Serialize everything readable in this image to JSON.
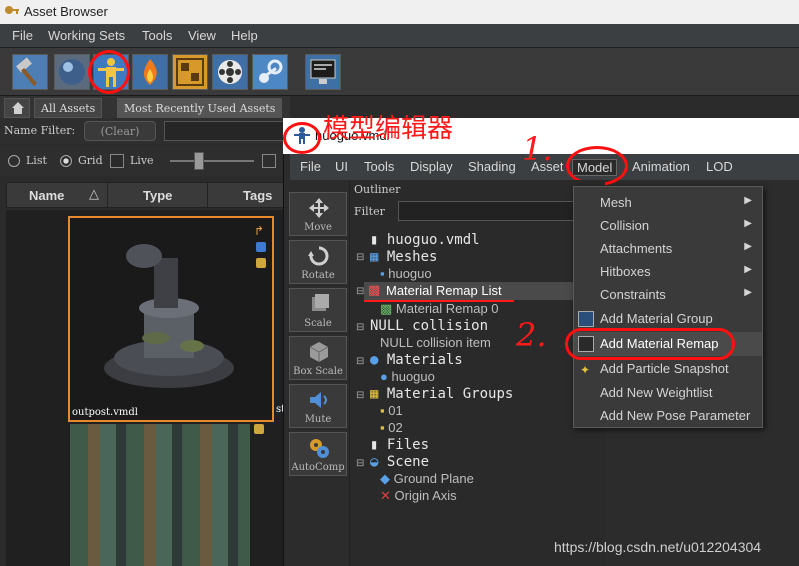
{
  "window": {
    "title": "Asset Browser"
  },
  "menubar": [
    "File",
    "Working Sets",
    "Tools",
    "View",
    "Help"
  ],
  "tabs": {
    "all": "All Assets",
    "recent": "Most Recently Used Assets"
  },
  "filter": {
    "label": "Name Filter:",
    "clear": "(Clear)"
  },
  "view": {
    "list": "List",
    "grid": "Grid",
    "live": "Live"
  },
  "columns": {
    "name": "Name",
    "type": "Type",
    "tags": "Tags"
  },
  "assets": [
    {
      "name": "outpost.vmdl"
    },
    {
      "name": "st"
    }
  ],
  "annotation": {
    "model_editor_cn": "模型编辑器",
    "step1": "1.",
    "step2": "2."
  },
  "model_editor": {
    "file": "huoguo.vmdl",
    "menus": [
      "File",
      "UI",
      "Tools",
      "Display",
      "Shading",
      "Asset",
      "Model",
      "Animation",
      "LOD"
    ],
    "tools": [
      "Move",
      "Rotate",
      "Scale",
      "Box Scale",
      "Mute",
      "AutoComp"
    ],
    "outliner": {
      "title": "Outliner",
      "filter_label": "Filter",
      "items": [
        {
          "label": "huoguo.vmdl",
          "kind": "head"
        },
        {
          "label": "Meshes",
          "kind": "head"
        },
        {
          "label": "huoguo",
          "kind": "leaf"
        },
        {
          "label": "Material Remap List",
          "kind": "leaf"
        },
        {
          "label": "Material Remap 0",
          "kind": "leaf"
        },
        {
          "label": "NULL collision",
          "kind": "head"
        },
        {
          "label": "NULL collision item",
          "kind": "leaf"
        },
        {
          "label": "Materials",
          "kind": "head"
        },
        {
          "label": "huoguo",
          "kind": "leaf"
        },
        {
          "label": "Material Groups",
          "kind": "head"
        },
        {
          "label": "01",
          "kind": "leaf"
        },
        {
          "label": "02",
          "kind": "leaf"
        },
        {
          "label": "Files",
          "kind": "head"
        },
        {
          "label": "Scene",
          "kind": "head"
        },
        {
          "label": "Ground Plane",
          "kind": "leaf"
        },
        {
          "label": "Origin Axis",
          "kind": "leaf"
        }
      ]
    },
    "model_menu": [
      {
        "label": "Mesh",
        "submenu": true
      },
      {
        "label": "Collision",
        "submenu": true
      },
      {
        "label": "Attachments",
        "submenu": true
      },
      {
        "label": "Hitboxes",
        "submenu": true
      },
      {
        "label": "Constraints",
        "submenu": true
      },
      {
        "label": "Add Material Group",
        "submenu": false
      },
      {
        "label": "Add Material Remap",
        "submenu": false
      },
      {
        "label": "Add Particle Snapshot",
        "submenu": false
      },
      {
        "label": "Add New Weightlist",
        "submenu": false
      },
      {
        "label": "Add New Pose Parameter",
        "submenu": false
      }
    ]
  },
  "watermark": "https://blog.csdn.net/u012204304",
  "colors": {
    "accent": "#3e6fa5",
    "annotation": "#ff1a1a",
    "selection": "#e88a2a"
  }
}
